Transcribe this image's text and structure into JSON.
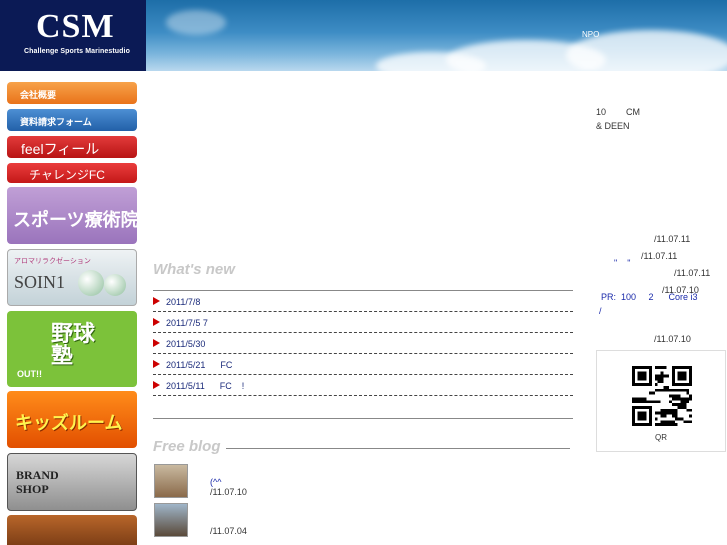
{
  "header": {
    "logo_text": "CSM",
    "logo_subtitle": "Challenge Sports Marinestudio",
    "npo_label": "NPO"
  },
  "sidebar": {
    "items": [
      {
        "label": "会社概要"
      },
      {
        "label": "資料請求フォーム"
      },
      {
        "label": "feelフィール"
      },
      {
        "label": "チャレンジFC"
      },
      {
        "label": "スポーツ療術院"
      },
      {
        "label_top": "アロマリラクゼーション",
        "label": "SOIN1"
      },
      {
        "label": "野球塾",
        "sub": "OUT!!"
      },
      {
        "label": "キッズルーム"
      },
      {
        "label": "BRAND SHOP"
      }
    ]
  },
  "whats_new": {
    "title": "What's new",
    "items": [
      {
        "text": "2011/7/8"
      },
      {
        "text": "2011/7/5 7"
      },
      {
        "text": "2011/5/30"
      },
      {
        "text": "2011/5/21      FC"
      },
      {
        "text": "2011/5/11      FC    !"
      }
    ]
  },
  "free_blog": {
    "title": "Free blog",
    "entries": [
      {
        "link": "(^^",
        "date": "/11.07.10"
      },
      {
        "link": "",
        "date": "/11.07.04"
      }
    ]
  },
  "right": {
    "intro_line1": "10        CM",
    "intro_line2": "& DEEN",
    "list": [
      {
        "link": "",
        "date": "/11.07.11"
      },
      {
        "link": "",
        "date": "/11.07.11"
      },
      {
        "link": "\"    \"",
        "date": "/11.07.11"
      },
      {
        "link": "",
        "date": "/11.07.10"
      },
      {
        "link": "PR:  100     2      Core i3",
        "date": ""
      },
      {
        "link": "/",
        "date": ""
      },
      {
        "link": "",
        "date": "/11.07.10"
      }
    ],
    "qr_label": "QR"
  }
}
